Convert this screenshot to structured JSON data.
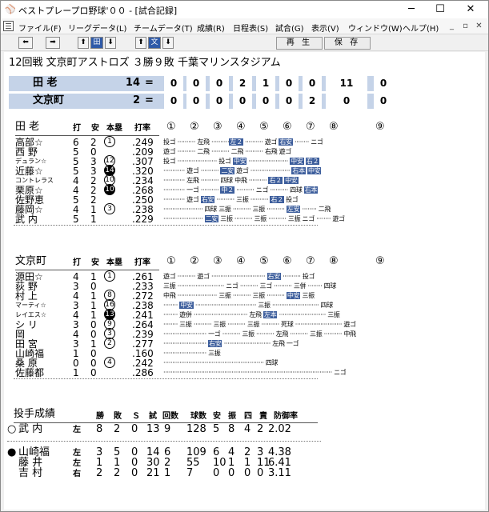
{
  "window": {
    "title": "ベストプレープロ野球'００ - [試合記録]",
    "min": "─",
    "max": "☐",
    "close": "✕"
  },
  "menu": [
    "ファイル(F)",
    "リーグデータ(L)",
    "チームデータ(T)",
    "成績(R)",
    "日程表(S)",
    "試合(G)",
    "表示(V)",
    "ウィンドウ(W)",
    "ヘルプ(H)"
  ],
  "mdi": {
    "min": "_",
    "restore": "▫",
    "close": "✕"
  },
  "toolbar": {
    "prev": "⬅",
    "next": "➡",
    "up1": "⬆",
    "home_team": "田",
    "down1": "⬇",
    "up2": "⬆",
    "away_team": "文",
    "down2": "⬇",
    "replay": "再 生",
    "save": "保 存"
  },
  "game": {
    "header": "12回戦 文京町アストロズ ３勝９敗 千葉マリンスタジアム"
  },
  "scoreboard": [
    {
      "team": "田 老",
      "runs": "14",
      "eq": "=",
      "innings": [
        "0",
        "0",
        "0",
        "2",
        "1",
        "0",
        "0",
        "11",
        "0"
      ]
    },
    {
      "team": "文京町",
      "runs": "2",
      "eq": "=",
      "innings": [
        "0",
        "0",
        "0",
        "0",
        "0",
        "0",
        "2",
        "0",
        "0"
      ]
    }
  ],
  "inning_labels": [
    "①",
    "②",
    "③",
    "④",
    "⑤",
    "⑥",
    "⑦",
    "⑧",
    "⑨"
  ],
  "col_headers": {
    "ab": "打",
    "h": "安",
    "hr": "本塁",
    "avg": "打率"
  },
  "team1": {
    "name": "田 老",
    "batters": [
      {
        "name": "高部☆",
        "ab": "6",
        "h": "2",
        "hr": "1",
        "hrf": false,
        "avg": ".249",
        "res": [
          {
            "t": "投ゴ ·········· 左飛 ··········",
            "h": false
          },
          {
            "t": "左２",
            "h": true
          },
          {
            "t": " ·········· 遊ゴ ",
            "h": false
          },
          {
            "t": "右安",
            "h": true
          },
          {
            "t": " ········ ニゴ",
            "h": false
          }
        ]
      },
      {
        "name": "西 野",
        "ab": "5",
        "h": "0",
        "hr": "",
        "hrf": false,
        "avg": ".209",
        "res": [
          {
            "t": "遊ゴ ·········· 二飛 ·········· 二飛 ·········· 右飛 遊ゴ",
            "h": false
          }
        ]
      },
      {
        "name": "デュラン☆",
        "ab": "5",
        "h": "3",
        "hr": "12",
        "hrf": false,
        "avg": ".307",
        "res": [
          {
            "t": "投ゴ ······················ 投ゴ ",
            "h": false
          },
          {
            "t": "中安",
            "h": true
          },
          {
            "t": " ······················ ",
            "h": false
          },
          {
            "t": "中安",
            "h": true
          },
          {
            "t": " ",
            "h": false
          },
          {
            "t": "右２",
            "h": true
          }
        ]
      },
      {
        "name": "近藤☆",
        "ab": "5",
        "h": "3",
        "hr": "14",
        "hrf": true,
        "avg": ".320",
        "res": [
          {
            "t": "············ 遊ゴ ·········· ",
            "h": false
          },
          {
            "t": "二安",
            "h": true
          },
          {
            "t": " 遊ゴ ······················ ",
            "h": false
          },
          {
            "t": "右本",
            "h": true
          },
          {
            "t": " ",
            "h": false
          },
          {
            "t": "中安",
            "h": true
          }
        ]
      },
      {
        "name": "コントレラス",
        "ab": "4",
        "h": "2",
        "hr": "10",
        "hrf": false,
        "avg": ".234",
        "res": [
          {
            "t": "············ 左飛 ·········· 四球 中飛 ·········· ",
            "h": false
          },
          {
            "t": "右２",
            "h": true
          },
          {
            "t": " ",
            "h": false
          },
          {
            "t": "中安",
            "h": true
          }
        ]
      },
      {
        "name": "栗原☆",
        "ab": "4",
        "h": "2",
        "hr": "10",
        "hrf": true,
        "avg": ".268",
        "res": [
          {
            "t": "············ 一ゴ ·········· ",
            "h": false
          },
          {
            "t": "中２",
            "h": true
          },
          {
            "t": " ·········· ニゴ ·········· 四球 ",
            "h": false
          },
          {
            "t": "右本",
            "h": true
          }
        ]
      },
      {
        "name": "佐野恵",
        "ab": "5",
        "h": "2",
        "hr": "",
        "hrf": false,
        "avg": ".250",
        "res": [
          {
            "t": "············ 遊ゴ ",
            "h": false
          },
          {
            "t": "右安",
            "h": true
          },
          {
            "t": " ·········· 三振 ·········· ",
            "h": false
          },
          {
            "t": "右２",
            "h": true
          },
          {
            "t": " 投ゴ",
            "h": false
          }
        ]
      },
      {
        "name": "藤岡☆",
        "ab": "4",
        "h": "1",
        "hr": "3",
        "hrf": false,
        "avg": ".238",
        "res": [
          {
            "t": "······················ 四球 三振 ·········· 三振 ·········· ",
            "h": false
          },
          {
            "t": "左安",
            "h": true
          },
          {
            "t": " ········ 二飛",
            "h": false
          }
        ]
      },
      {
        "name": "武 内",
        "ab": "5",
        "h": "1",
        "hr": "",
        "hrf": false,
        "avg": ".229",
        "res": [
          {
            "t": "······················ ",
            "h": false
          },
          {
            "t": "二安",
            "h": true
          },
          {
            "t": " 三振 ·········· 三振 ·········· 三振 ニゴ ········ 遊ゴ",
            "h": false
          }
        ]
      }
    ]
  },
  "team2": {
    "name": "文京町",
    "batters": [
      {
        "name": "源田☆",
        "ab": "4",
        "h": "1",
        "hr": "1",
        "hrf": false,
        "avg": ".261",
        "res": [
          {
            "t": "遊ゴ ·········· 遊ゴ ······························ ",
            "h": false
          },
          {
            "t": "右安",
            "h": true
          },
          {
            "t": " ·········· 投ゴ",
            "h": false
          }
        ]
      },
      {
        "name": "荻 野",
        "ab": "3",
        "h": "0",
        "hr": "",
        "hrf": false,
        "avg": ".233",
        "res": [
          {
            "t": "三振 ·························· ニゴ ·········· 三ゴ ·········· 三併 ········ 四球",
            "h": false
          }
        ]
      },
      {
        "name": "村 上",
        "ab": "4",
        "h": "1",
        "hr": "8",
        "hrf": false,
        "avg": ".272",
        "res": [
          {
            "t": "中飛 ······················ 三振 ·········· 三振 ·········· ",
            "h": false
          },
          {
            "t": "中安",
            "h": true
          },
          {
            "t": " 三振",
            "h": false
          }
        ]
      },
      {
        "name": "マーティ☆",
        "ab": "3",
        "h": "1",
        "hr": "16",
        "hrf": false,
        "avg": ".238",
        "res": [
          {
            "t": "········ ",
            "h": false
          },
          {
            "t": "中安",
            "h": true
          },
          {
            "t": " ·································· 三振 ·························· 四球",
            "h": false
          }
        ]
      },
      {
        "name": "レイエス☆",
        "ab": "4",
        "h": "1",
        "hr": "13",
        "hrf": true,
        "avg": ".241",
        "res": [
          {
            "t": "········ 遊併 ······························ 左飛 ",
            "h": false
          },
          {
            "t": "左本",
            "h": true
          },
          {
            "t": " ·························· 三振",
            "h": false
          }
        ]
      },
      {
        "name": "シ リ",
        "ab": "3",
        "h": "0",
        "hr": "9",
        "hrf": false,
        "avg": ".264",
        "res": [
          {
            "t": "········ 三振 ·········· 三振 ·········· 三振 ·········· 死球 ·························· 遊ゴ",
            "h": false
          }
        ]
      },
      {
        "name": "岡",
        "ab": "4",
        "h": "0",
        "hr": "3",
        "hrf": false,
        "avg": ".239",
        "res": [
          {
            "t": "························ 一ゴ ·········· 三振 ·········· 左飛 ·········· 三振 ·········· 中飛",
            "h": false
          }
        ]
      },
      {
        "name": "田 宮",
        "ab": "3",
        "h": "1",
        "hr": "2",
        "hrf": false,
        "avg": ".277",
        "res": [
          {
            "t": "························ ",
            "h": false
          },
          {
            "t": "右安",
            "h": true
          },
          {
            "t": " ·························· 左飛 一ゴ",
            "h": false
          }
        ]
      },
      {
        "name": "山崎福",
        "ab": "1",
        "h": "0",
        "hr": "",
        "hrf": false,
        "avg": ".160",
        "res": [
          {
            "t": "························ 三振",
            "h": false
          }
        ]
      },
      {
        "name": "桑 原",
        "ab": "0",
        "h": "0",
        "hr": "4",
        "hrf": false,
        "avg": ".242",
        "res": [
          {
            "t": "························································ 四球",
            "h": false
          }
        ]
      },
      {
        "name": "佐藤都",
        "ab": "1",
        "h": "0",
        "hr": "",
        "hrf": false,
        "avg": ".286",
        "res": [
          {
            "t": "······························································································ ニゴ",
            "h": false
          }
        ]
      }
    ]
  },
  "pitching": {
    "title": "投手成績",
    "headers": [
      "勝",
      "敗",
      "Ｓ",
      "試",
      "回数",
      "球数",
      "安",
      "振",
      "四",
      "責",
      "防御率"
    ],
    "rows": [
      {
        "mark": "○",
        "name": "武 内",
        "hand": "左",
        "w": "8",
        "l": "2",
        "s": "0",
        "g": "13",
        "ip": "9",
        "np": "128",
        "h": "5",
        "so": "8",
        "bb": "4",
        "er": "2",
        "era": "2.02"
      },
      {
        "mark": "●",
        "name": "山崎福",
        "hand": "左",
        "w": "3",
        "l": "5",
        "s": "0",
        "g": "14",
        "ip": "6",
        "np": "109",
        "h": "6",
        "so": "4",
        "bb": "2",
        "er": "3",
        "era": "4.38"
      },
      {
        "mark": "",
        "name": "藤 井",
        "hand": "左",
        "w": "1",
        "l": "1",
        "s": "0",
        "g": "30",
        "ip": "2",
        "np": "55",
        "h": "10",
        "so": "1",
        "bb": "1",
        "er": "11",
        "era": "6.41"
      },
      {
        "mark": "",
        "name": "吉 村",
        "hand": "右",
        "w": "2",
        "l": "2",
        "s": "0",
        "g": "21",
        "ip": "1",
        "np": "7",
        "h": "0",
        "so": "0",
        "bb": "0",
        "er": "0",
        "era": "3.11"
      }
    ]
  }
}
